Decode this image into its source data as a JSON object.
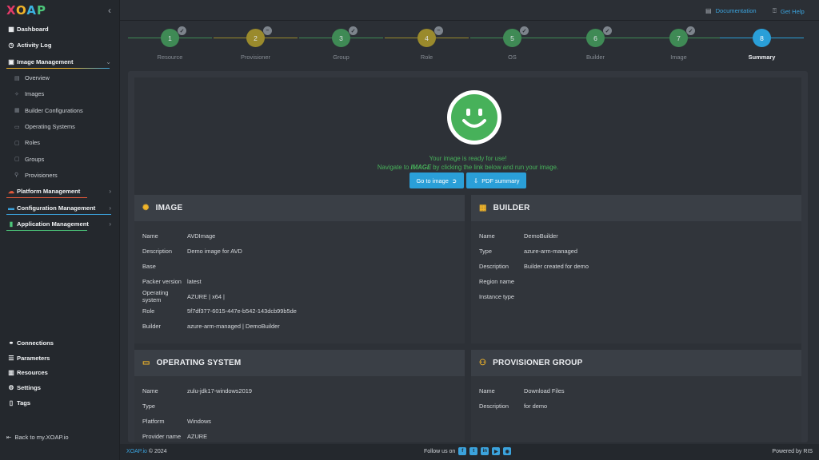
{
  "brand": {
    "letters": [
      "X",
      "O",
      "A",
      "P"
    ]
  },
  "sidebar": {
    "items": [
      {
        "label": "Dashboard",
        "icon": "grid-icon"
      },
      {
        "label": "Activity Log",
        "icon": "clock-icon"
      },
      {
        "label": "Image Management",
        "icon": "image-icon",
        "expanded": true
      }
    ],
    "sub_items": [
      {
        "label": "Overview"
      },
      {
        "label": "Images"
      },
      {
        "label": "Builder Configurations"
      },
      {
        "label": "Operating Systems"
      },
      {
        "label": "Roles"
      },
      {
        "label": "Groups"
      },
      {
        "label": "Provisioners"
      }
    ],
    "groups": [
      {
        "label": "Platform Management",
        "color": "#e2593a"
      },
      {
        "label": "Configuration Management",
        "color": "#3ba3dd"
      },
      {
        "label": "Application Management",
        "color": "#4cc67a"
      }
    ],
    "bottom": [
      {
        "label": "Connections"
      },
      {
        "label": "Parameters"
      },
      {
        "label": "Resources"
      },
      {
        "label": "Settings"
      },
      {
        "label": "Tags"
      }
    ],
    "back_link": "Back to my.XOAP.io"
  },
  "topbar": {
    "documentation": "Documentation",
    "help": "Get Help"
  },
  "stepper": {
    "steps": [
      {
        "number": "1",
        "label": "Resource",
        "color": "#3f8a55"
      },
      {
        "number": "2",
        "label": "Provisioner",
        "color": "#9a8a2c"
      },
      {
        "number": "3",
        "label": "Group",
        "color": "#3f8a55"
      },
      {
        "number": "4",
        "label": "Role",
        "color": "#9a8a2c"
      },
      {
        "number": "5",
        "label": "OS",
        "color": "#3f8a55"
      },
      {
        "number": "6",
        "label": "Builder",
        "color": "#3f8a55"
      },
      {
        "number": "7",
        "label": "Image",
        "color": "#3f8a55"
      },
      {
        "number": "8",
        "label": "Summary",
        "color": "#2a9fd8",
        "active": true
      }
    ]
  },
  "summary": {
    "ready_message": "Your image is ready for use!",
    "nav_prefix": "Navigate to ",
    "nav_emphasis": "IMAGE",
    "nav_suffix": " by clicking the link below and run your image.",
    "go_to_image": "Go to image",
    "pdf_summary": "PDF summary"
  },
  "image_card": {
    "title": "IMAGE",
    "rows": [
      {
        "key": "Name",
        "value": "AVDImage"
      },
      {
        "key": "Description",
        "value": "Demo image for AVD"
      },
      {
        "key": "Base",
        "value": ""
      },
      {
        "key": "Packer version",
        "value": "latest"
      },
      {
        "key": "Operating system",
        "value": "AZURE | x64 |"
      },
      {
        "key": "Role",
        "value": "5f7df377-6015-447e-b542-143dcb99b5de"
      },
      {
        "key": "Builder",
        "value": "azure-arm-managed | DemoBuilder"
      }
    ]
  },
  "builder_card": {
    "title": "BUILDER",
    "rows": [
      {
        "key": "Name",
        "value": "DemoBuilder"
      },
      {
        "key": "Type",
        "value": "azure-arm-managed"
      },
      {
        "key": "Description",
        "value": "Builder created for demo"
      },
      {
        "key": "Region name",
        "value": ""
      },
      {
        "key": "Instance type",
        "value": ""
      }
    ]
  },
  "os_card": {
    "title": "OPERATING SYSTEM",
    "rows": [
      {
        "key": "Name",
        "value": "zulu-jdk17-windows2019"
      },
      {
        "key": "Type",
        "value": ""
      },
      {
        "key": "Platform",
        "value": "Windows"
      },
      {
        "key": "Provider name",
        "value": "AZURE"
      }
    ]
  },
  "provisioner_card": {
    "title": "PROVISIONER GROUP",
    "rows": [
      {
        "key": "Name",
        "value": "Download Files"
      },
      {
        "key": "Description",
        "value": "for demo"
      }
    ]
  },
  "footer": {
    "brand": "XOAP.io",
    "copyright": " © 2024",
    "follow": "Follow us on",
    "powered": "Powered by RIS"
  },
  "colors": {
    "accent": "#2a9fd8",
    "success": "#47b15a",
    "warning": "#f0b429"
  }
}
